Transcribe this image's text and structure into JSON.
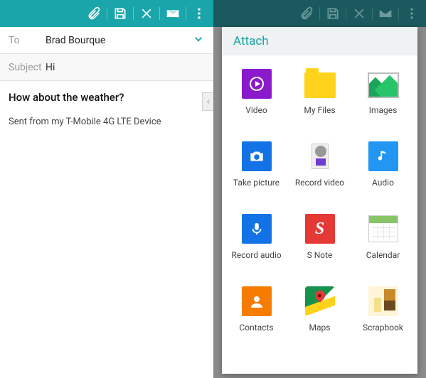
{
  "colors": {
    "teal": "#1aa5ab",
    "tealDark": "#1a5a5e"
  },
  "actionbar": {
    "icons": [
      "attach-icon",
      "save-icon",
      "close-icon",
      "send-icon",
      "overflow-icon"
    ]
  },
  "compose": {
    "to_label": "To",
    "to_value": "Brad Bourque",
    "subject_label": "Subject",
    "subject_value": "Hi",
    "body": "How about the weather?",
    "signature": "Sent from my T-Mobile 4G LTE Device"
  },
  "attach": {
    "header": "Attach",
    "items": [
      {
        "id": "video",
        "label": "Video"
      },
      {
        "id": "my-files",
        "label": "My Files"
      },
      {
        "id": "images",
        "label": "Images"
      },
      {
        "id": "take-picture",
        "label": "Take picture"
      },
      {
        "id": "record-video",
        "label": "Record video"
      },
      {
        "id": "audio",
        "label": "Audio"
      },
      {
        "id": "record-audio",
        "label": "Record audio"
      },
      {
        "id": "s-note",
        "label": "S Note"
      },
      {
        "id": "calendar",
        "label": "Calendar"
      },
      {
        "id": "contacts",
        "label": "Contacts"
      },
      {
        "id": "maps",
        "label": "Maps"
      },
      {
        "id": "scrapbook",
        "label": "Scrapbook"
      }
    ]
  }
}
